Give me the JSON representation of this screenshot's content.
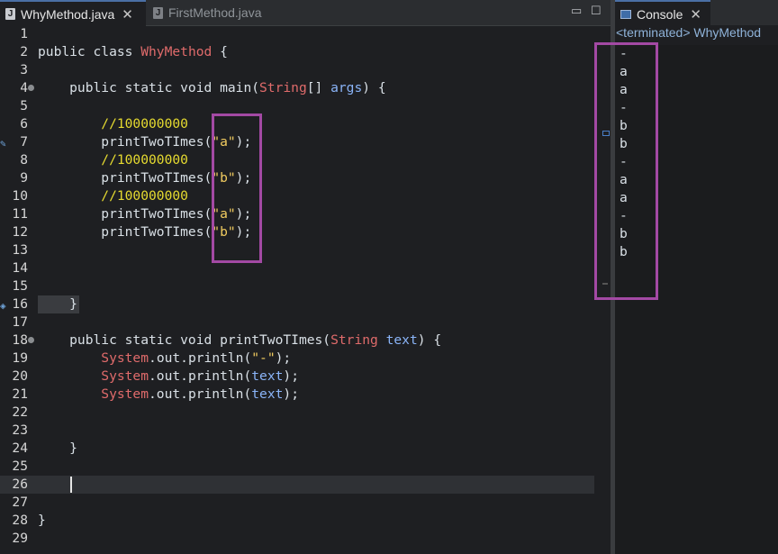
{
  "editor": {
    "tabs": [
      {
        "label": "WhyMethod.java",
        "active": true
      },
      {
        "label": "FirstMethod.java",
        "active": false
      }
    ],
    "file_icon_letter": "J",
    "close_glyph": "✕",
    "minimize_glyph": "▭",
    "maximize_glyph": "☐",
    "lines": [
      {
        "n": "1",
        "tokens": []
      },
      {
        "n": "2",
        "tokens": [
          [
            "kw",
            "public class "
          ],
          [
            "cls",
            "WhyMethod"
          ],
          [
            "kw",
            " {"
          ]
        ]
      },
      {
        "n": "3",
        "tokens": []
      },
      {
        "n": "4",
        "fold": true,
        "tokens": [
          [
            "kw",
            "    public static void main("
          ],
          [
            "cls",
            "String"
          ],
          [
            "kw",
            "[] "
          ],
          [
            "var",
            "args"
          ],
          [
            "kw",
            ") {"
          ]
        ]
      },
      {
        "n": "5",
        "tokens": []
      },
      {
        "n": "6",
        "tokens": [
          [
            "cmt",
            "        //100000000"
          ]
        ]
      },
      {
        "n": "7",
        "mark": "edit",
        "tokens": [
          [
            "kw",
            "        printTwoTImes("
          ],
          [
            "str",
            "\"a\""
          ],
          [
            "kw",
            ");"
          ]
        ]
      },
      {
        "n": "8",
        "tokens": [
          [
            "cmt",
            "        //100000000"
          ]
        ]
      },
      {
        "n": "9",
        "tokens": [
          [
            "kw",
            "        printTwoTImes("
          ],
          [
            "str",
            "\"b\""
          ],
          [
            "kw",
            ");"
          ]
        ]
      },
      {
        "n": "10",
        "tokens": [
          [
            "cmt",
            "        //100000000"
          ]
        ]
      },
      {
        "n": "11",
        "tokens": [
          [
            "kw",
            "        printTwoTImes("
          ],
          [
            "str",
            "\"a\""
          ],
          [
            "kw",
            ");"
          ]
        ]
      },
      {
        "n": "12",
        "tokens": [
          [
            "kw",
            "        printTwoTImes("
          ],
          [
            "str",
            "\"b\""
          ],
          [
            "kw",
            ");"
          ]
        ]
      },
      {
        "n": "13",
        "tokens": []
      },
      {
        "n": "14",
        "tokens": []
      },
      {
        "n": "15",
        "tokens": []
      },
      {
        "n": "16",
        "mark": "diamond",
        "tokens": [
          [
            "kw",
            "    }"
          ]
        ]
      },
      {
        "n": "17",
        "tokens": []
      },
      {
        "n": "18",
        "fold": true,
        "tokens": [
          [
            "kw",
            "    public static void printTwoTImes("
          ],
          [
            "cls",
            "String"
          ],
          [
            "kw",
            " "
          ],
          [
            "var",
            "text"
          ],
          [
            "kw",
            ") {"
          ]
        ]
      },
      {
        "n": "19",
        "tokens": [
          [
            "cls",
            "        System"
          ],
          [
            "kw",
            "."
          ],
          [
            "kw",
            "out"
          ],
          [
            "kw",
            ".println("
          ],
          [
            "str",
            "\"-\""
          ],
          [
            "kw",
            ");"
          ]
        ]
      },
      {
        "n": "20",
        "tokens": [
          [
            "cls",
            "        System"
          ],
          [
            "kw",
            ".out.println("
          ],
          [
            "var",
            "text"
          ],
          [
            "kw",
            ");"
          ]
        ]
      },
      {
        "n": "21",
        "tokens": [
          [
            "cls",
            "        System"
          ],
          [
            "kw",
            ".out.println("
          ],
          [
            "var",
            "text"
          ],
          [
            "kw",
            ");"
          ]
        ]
      },
      {
        "n": "22",
        "tokens": []
      },
      {
        "n": "23",
        "tokens": []
      },
      {
        "n": "24",
        "tokens": [
          [
            "kw",
            "    }"
          ]
        ]
      },
      {
        "n": "25",
        "tokens": []
      },
      {
        "n": "26",
        "current": true,
        "tokens": []
      },
      {
        "n": "27",
        "tokens": []
      },
      {
        "n": "28",
        "tokens": [
          [
            "kw",
            "}"
          ]
        ]
      },
      {
        "n": "29",
        "tokens": []
      }
    ]
  },
  "console": {
    "tab_label": "Console",
    "close_glyph": "✕",
    "status": "<terminated> WhyMethod",
    "output": [
      "-",
      "a",
      "a",
      "-",
      "b",
      "b",
      "-",
      "a",
      "a",
      "-",
      "b",
      "b"
    ]
  },
  "colors": {
    "highlight_box": "#a349a4",
    "string": "#f2cc60",
    "comment": "#e6db30",
    "class": "#e06b6b",
    "variable": "#8ab4f8"
  }
}
